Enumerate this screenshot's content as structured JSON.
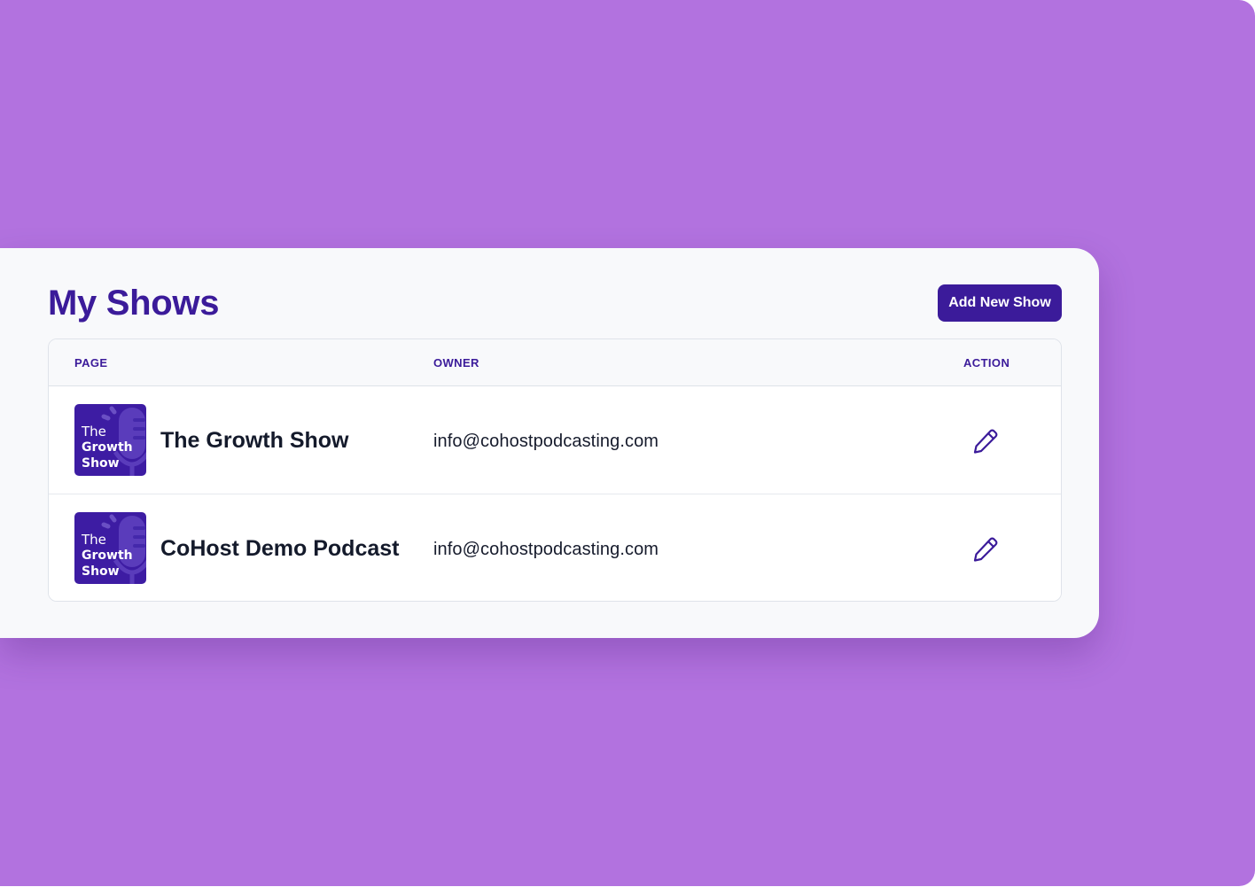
{
  "page": {
    "title": "My Shows",
    "add_button_label": "Add New Show"
  },
  "table": {
    "columns": [
      "PAGE",
      "OWNER",
      "ACTION"
    ],
    "rows": [
      {
        "thumbnail": {
          "line1": "The",
          "line2": "Growth",
          "line3": "Show",
          "icon": "microphone-icon"
        },
        "name": "The Growth Show",
        "owner": "info@cohostpodcasting.com",
        "action_icon": "pencil-icon"
      },
      {
        "thumbnail": {
          "line1": "The",
          "line2": "Growth",
          "line3": "Show",
          "icon": "microphone-icon"
        },
        "name": "CoHost Demo Podcast",
        "owner": "info@cohostpodcasting.com",
        "action_icon": "pencil-icon"
      }
    ]
  },
  "colors": {
    "background": "#b272df",
    "card": "#f8f9fb",
    "brand": "#3b1b9a",
    "text": "#141a2b"
  }
}
